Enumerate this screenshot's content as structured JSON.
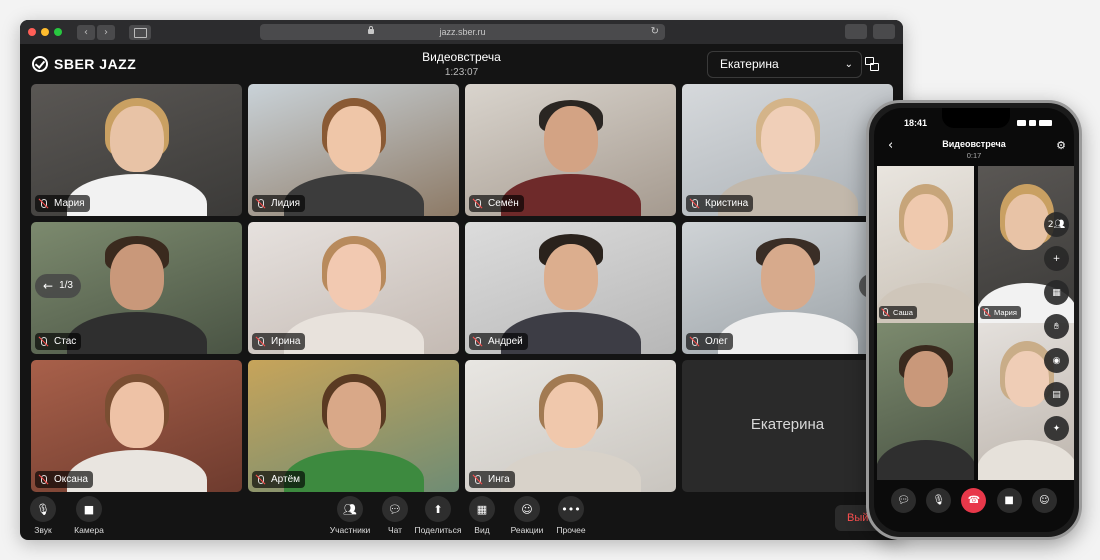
{
  "browser": {
    "address": "jazz.sber.ru",
    "colors": {
      "close": "#ff5f57",
      "minimize": "#febc2e",
      "zoom": "#28c840"
    }
  },
  "app": {
    "logo": "SBER JAZZ",
    "title": "Видеовстреча",
    "timer": "1:23:07",
    "current_user": "Екатерина",
    "accent": "#21a038"
  },
  "grid": {
    "page_indicator": "1/3",
    "tiles": [
      {
        "name": "Мария",
        "muted": true
      },
      {
        "name": "Лидия",
        "muted": true
      },
      {
        "name": "Семён",
        "muted": true
      },
      {
        "name": "Кристина",
        "muted": true
      },
      {
        "name": "Стас",
        "muted": true
      },
      {
        "name": "Ирина",
        "muted": true
      },
      {
        "name": "Андрей",
        "muted": true,
        "speaking": true
      },
      {
        "name": "Олег",
        "muted": true
      },
      {
        "name": "Оксана",
        "muted": true
      },
      {
        "name": "Артём",
        "muted": true
      },
      {
        "name": "Инга",
        "muted": true
      },
      {
        "name": "Екатерина",
        "camera_off": true
      }
    ]
  },
  "toolbar": {
    "sound": "Звук",
    "camera": "Камера",
    "participants": "Участники",
    "chat": "Чат",
    "share": "Поделиться",
    "view": "Вид",
    "reactions": "Реакции",
    "more": "Прочее",
    "exit": "Выйти",
    "exit_color": "#ff5050"
  },
  "phone": {
    "time": "18:41",
    "title": "Видеовстреча",
    "timer": "0:17",
    "participants_count": "2",
    "tiles": [
      {
        "name": "Саша"
      },
      {
        "name": "Мария"
      },
      {
        "name": ""
      },
      {
        "name": ""
      }
    ],
    "hangup_color": "#e8384a"
  }
}
